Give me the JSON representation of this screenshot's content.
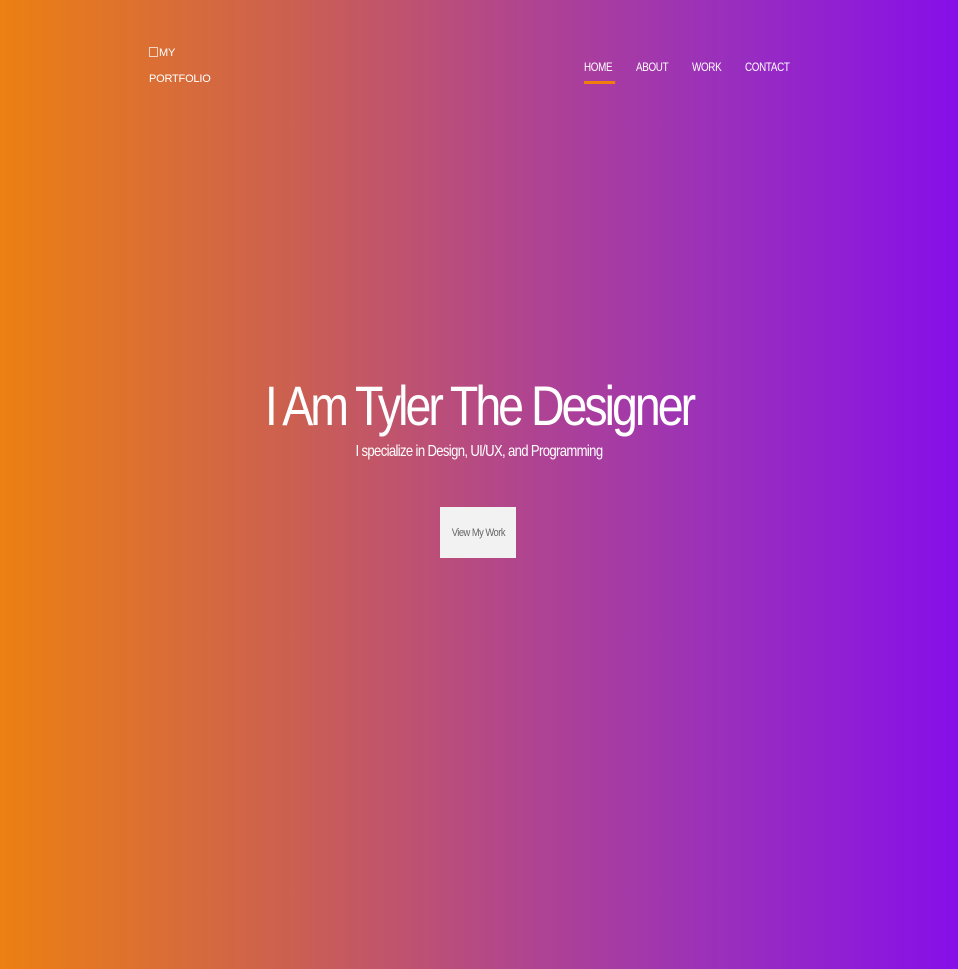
{
  "logo": {
    "alt_line1": "MY",
    "alt_line2": "PORTFOLIO"
  },
  "nav": {
    "items": [
      {
        "label": "HOME",
        "active": true
      },
      {
        "label": "ABOUT",
        "active": false
      },
      {
        "label": "WORK",
        "active": false
      },
      {
        "label": "CONTACT",
        "active": false
      }
    ]
  },
  "hero": {
    "title": "I Am Tyler The Designer",
    "tagline": "I specialize in Design, UI/UX, and Programming",
    "cta_label": "View My Work"
  },
  "colors": {
    "gradient_start": "#ec8012",
    "gradient_end": "#860fe9",
    "accent": "#ef7d0f",
    "button_bg": "#f2f2f2"
  },
  "icons": {
    "logo": "broken-image-icon"
  }
}
